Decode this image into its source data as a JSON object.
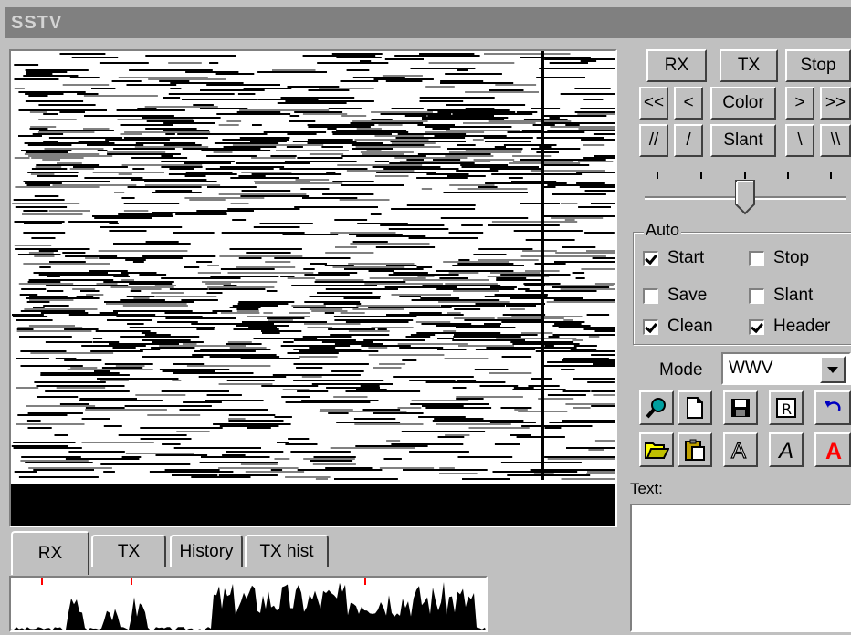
{
  "window": {
    "title": "SSTV"
  },
  "controls": {
    "row1": [
      "RX",
      "TX",
      "Stop"
    ],
    "row2": [
      "<<",
      "<",
      "Color",
      ">",
      ">>"
    ],
    "row3": [
      "//",
      "/",
      "Slant",
      "\\",
      "\\\\"
    ]
  },
  "slider": {
    "value": 0.5
  },
  "auto": {
    "legend": "Auto",
    "options": [
      {
        "label": "Start",
        "checked": true
      },
      {
        "label": "Stop",
        "checked": false
      },
      {
        "label": "Save",
        "checked": false
      },
      {
        "label": "Slant",
        "checked": false
      },
      {
        "label": "Clean",
        "checked": true
      },
      {
        "label": "Header",
        "checked": true
      }
    ]
  },
  "mode": {
    "label": "Mode",
    "value": "WWV"
  },
  "toolbar_icons": [
    "zoom-icon",
    "new-document-icon",
    "save-disk-icon",
    "register-r-icon",
    "undo-icon",
    "open-folder-icon",
    "paste-clipboard-icon",
    "font-outline-a-icon",
    "font-italic-a-icon",
    "font-color-a-icon"
  ],
  "text_panel": {
    "label": "Text:"
  },
  "tabs": [
    "RX",
    "TX",
    "History",
    "TX hist"
  ],
  "active_tab": "RX"
}
